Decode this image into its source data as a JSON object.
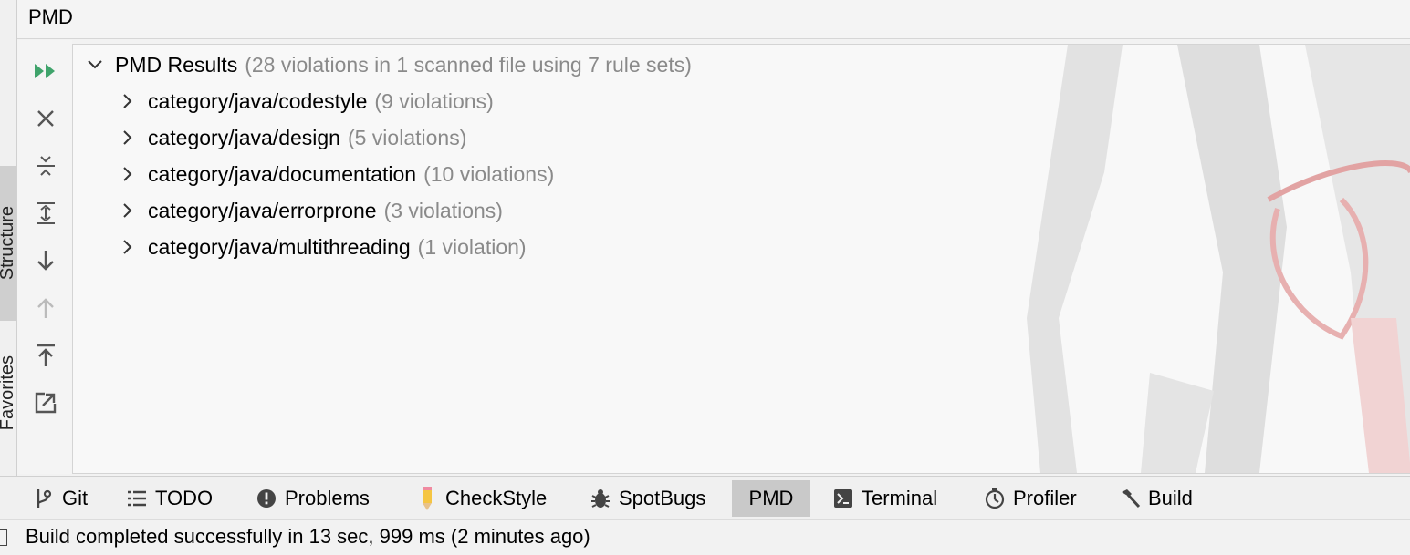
{
  "window": {
    "title": "PMD"
  },
  "side_tabs": {
    "structure": "Structure",
    "favorites": "Favorites"
  },
  "tree": {
    "root": {
      "label": "PMD Results",
      "summary": "(28 violations in 1 scanned file using 7 rule sets)"
    },
    "items": [
      {
        "label": "category/java/codestyle",
        "count": "(9 violations)"
      },
      {
        "label": "category/java/design",
        "count": "(5 violations)"
      },
      {
        "label": "category/java/documentation",
        "count": "(10 violations)"
      },
      {
        "label": "category/java/errorprone",
        "count": "(3 violations)"
      },
      {
        "label": "category/java/multithreading",
        "count": "(1 violation)"
      }
    ]
  },
  "toolbar": [
    {
      "name": "rerun-icon"
    },
    {
      "name": "close-icon"
    },
    {
      "name": "collapse-all-icon"
    },
    {
      "name": "expand-all-icon"
    },
    {
      "name": "next-icon"
    },
    {
      "name": "previous-icon"
    },
    {
      "name": "export-icon"
    },
    {
      "name": "open-external-icon"
    }
  ],
  "bottom_tabs": [
    {
      "label": "Git",
      "icon": "git-branch-icon"
    },
    {
      "label": "TODO",
      "icon": "list-icon"
    },
    {
      "label": "Problems",
      "icon": "warning-icon"
    },
    {
      "label": "CheckStyle",
      "icon": "pencil-icon"
    },
    {
      "label": "SpotBugs",
      "icon": "bug-icon"
    },
    {
      "label": "PMD",
      "icon": "",
      "active": true
    },
    {
      "label": "Terminal",
      "icon": "terminal-icon"
    },
    {
      "label": "Profiler",
      "icon": "profiler-icon"
    },
    {
      "label": "Build",
      "icon": "hammer-icon"
    }
  ],
  "status": {
    "message": "Build completed successfully in 13 sec, 999 ms (2 minutes ago)"
  },
  "colors": {
    "run_green": "#3fa36b",
    "muted_text": "#8a8a8a",
    "active_tab": "#c9c9c9",
    "icon_gray": "#555555"
  }
}
